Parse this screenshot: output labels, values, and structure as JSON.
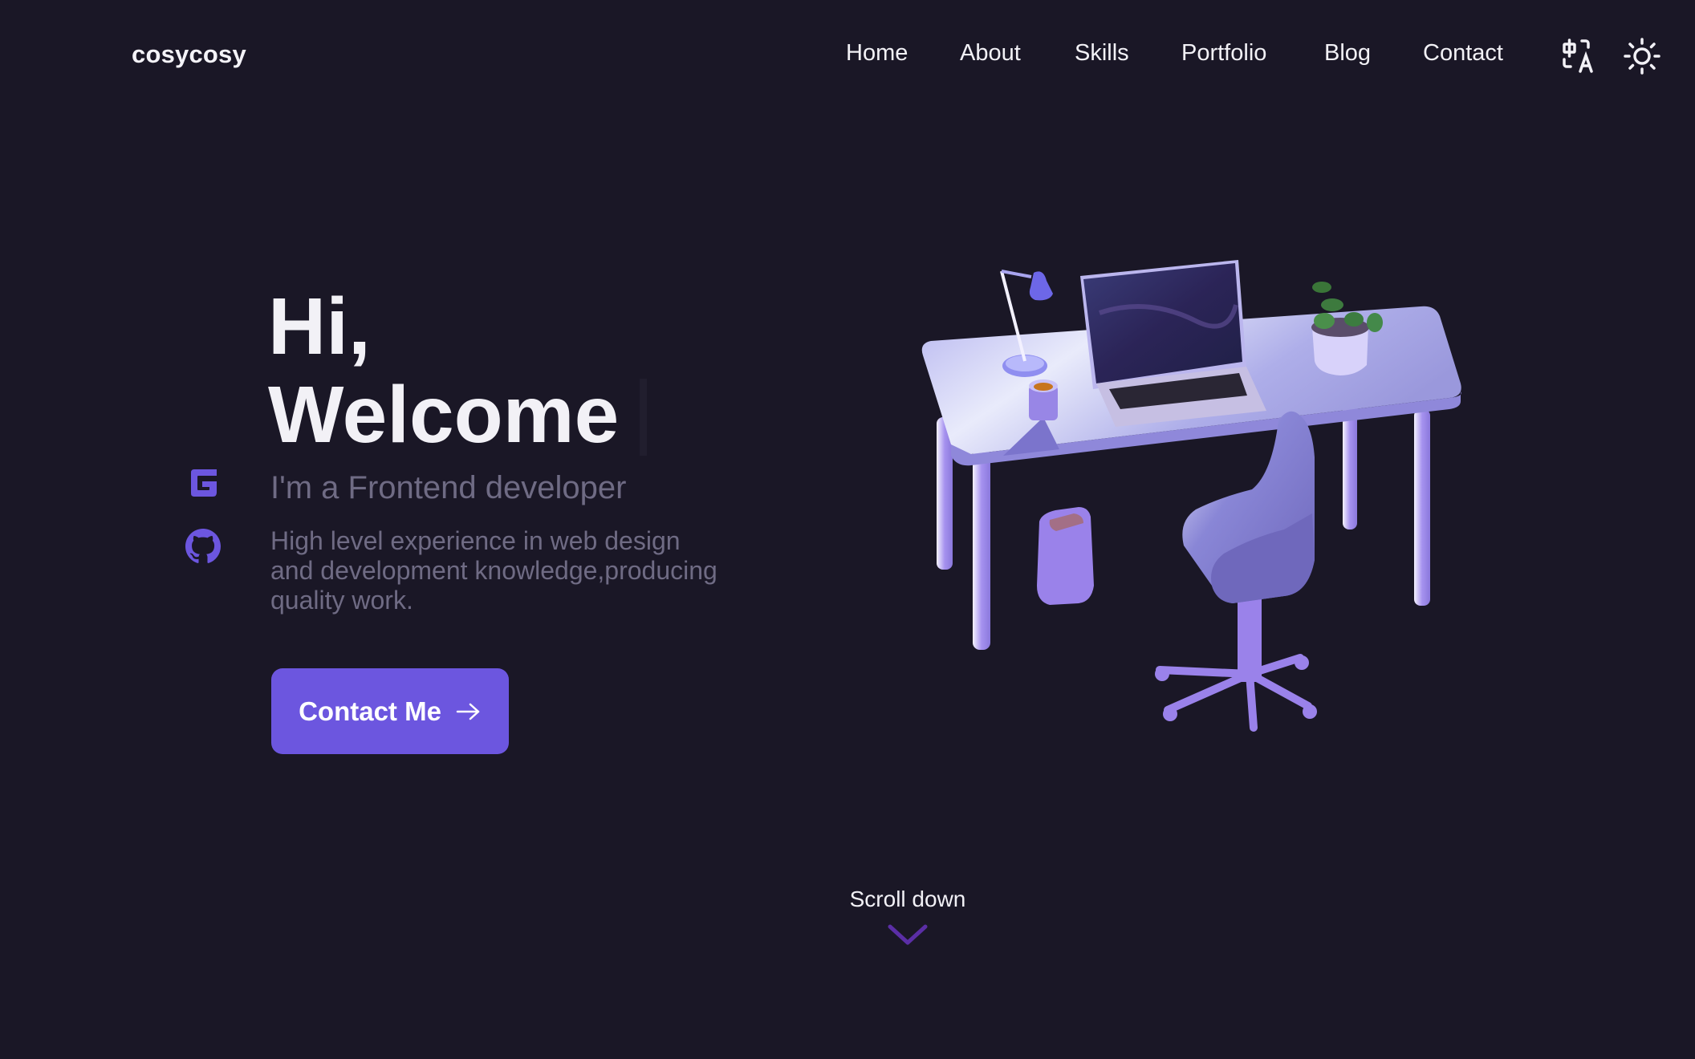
{
  "header": {
    "logo": "cosycosy",
    "nav": [
      {
        "label": "Home"
      },
      {
        "label": "About"
      },
      {
        "label": "Skills"
      },
      {
        "label": "Portfolio"
      },
      {
        "label": "Blog"
      },
      {
        "label": "Contact"
      }
    ],
    "language_icon": "translate-icon",
    "theme_icon": "sun-icon"
  },
  "hero": {
    "line1": "Hi,",
    "line2": "Welcome",
    "subtitle": "I'm a Frontend developer",
    "description": "High level experience in web design and development knowledge,producing quality work.",
    "cta_label": "Contact Me",
    "cta_icon": "arrow-right-icon"
  },
  "social": [
    {
      "icon": "gitee-icon"
    },
    {
      "icon": "github-icon"
    }
  ],
  "scroll": {
    "label": "Scroll down",
    "icon": "chevron-down-icon"
  },
  "illustration": {
    "subject": "3D desk workspace with laptop, lamp, cup, plant, chair and bin"
  },
  "colors": {
    "background": "#1a1726",
    "accent": "#6c56df",
    "muted_text": "#6f6b84",
    "chevron": "#5b2ea6"
  }
}
